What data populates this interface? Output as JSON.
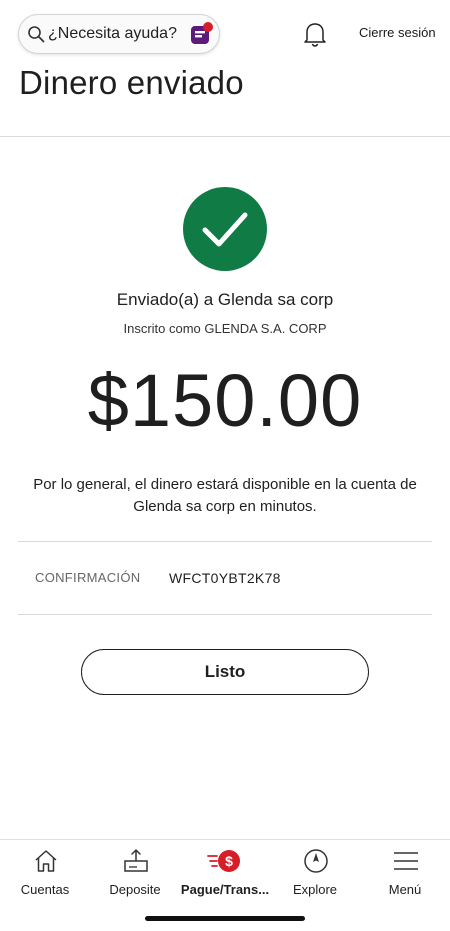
{
  "header": {
    "search_placeholder": "¿Necesita ayuda?",
    "signout_label": "Cierre sesión"
  },
  "page": {
    "title": "Dinero enviado"
  },
  "confirmation": {
    "sent_to": "Enviado(a) a Glenda sa corp",
    "enrolled_as": "Inscrito como GLENDA S.A. CORP",
    "amount": "$150.00",
    "availability_note": "Por lo general, el dinero estará disponible en la cuenta de Glenda sa corp en minutos.",
    "confirmation_label": "CONFIRMACIÓN",
    "confirmation_number": "WFCT0YBT2K78",
    "done_label": "Listo"
  },
  "tabs": [
    {
      "label": "Cuentas",
      "icon": "home-icon",
      "active": false
    },
    {
      "label": "Deposite",
      "icon": "deposit-icon",
      "active": false
    },
    {
      "label": "Pague/Trans...",
      "icon": "pay-transfer-icon",
      "active": true
    },
    {
      "label": "Explore",
      "icon": "compass-icon",
      "active": false
    },
    {
      "label": "Menú",
      "icon": "menu-icon",
      "active": false
    }
  ],
  "colors": {
    "success_green": "#117b45",
    "brand_red": "#d71e28",
    "brand_purple": "#5c1a7a"
  }
}
